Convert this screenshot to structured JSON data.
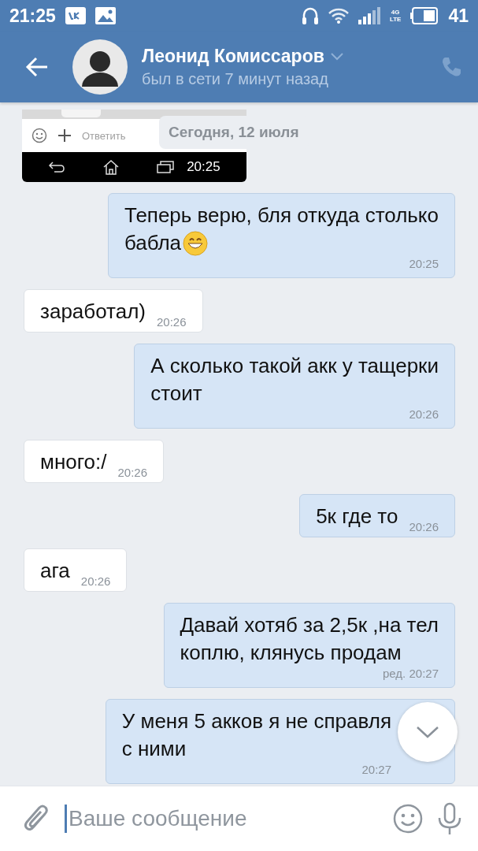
{
  "status_bar": {
    "time": "21:25",
    "network": [
      "4G",
      "LTE"
    ],
    "battery_text": "41"
  },
  "header": {
    "name": "Леонид Комиссаров",
    "status": "был в сети 7 минут назад"
  },
  "chat": {
    "attachment": {
      "reply_label": "Ответить",
      "time": "20:25"
    },
    "date": "Сегодня, 12 июля",
    "messages": [
      {
        "kind": "outgoing",
        "lines": [
          "Теперь верю, бля откуда столько",
          "бабла"
        ],
        "emoji": true,
        "time": "20:25"
      },
      {
        "kind": "incoming",
        "lines": [
          "заработал)"
        ],
        "time": "20:26"
      },
      {
        "kind": "outgoing",
        "lines": [
          "А сколько такой акк у тащерки",
          "стоит"
        ],
        "time": "20:26"
      },
      {
        "kind": "incoming",
        "lines": [
          "много:/"
        ],
        "time": "20:26"
      },
      {
        "kind": "outgoing",
        "lines": [
          "5к где то"
        ],
        "time": "20:26"
      },
      {
        "kind": "incoming",
        "lines": [
          "ага"
        ],
        "time": "20:26"
      },
      {
        "kind": "outgoing",
        "lines": [
          "Давай хотяб за 2,5к ,на тел",
          "коплю, клянусь продам"
        ],
        "time": "ред. 20:27"
      },
      {
        "kind": "outgoing",
        "lines": [
          "У меня 5 акков я не справля",
          "с ними"
        ],
        "time": "20:27"
      }
    ]
  },
  "composer": {
    "placeholder": "Ваше сообщение"
  }
}
